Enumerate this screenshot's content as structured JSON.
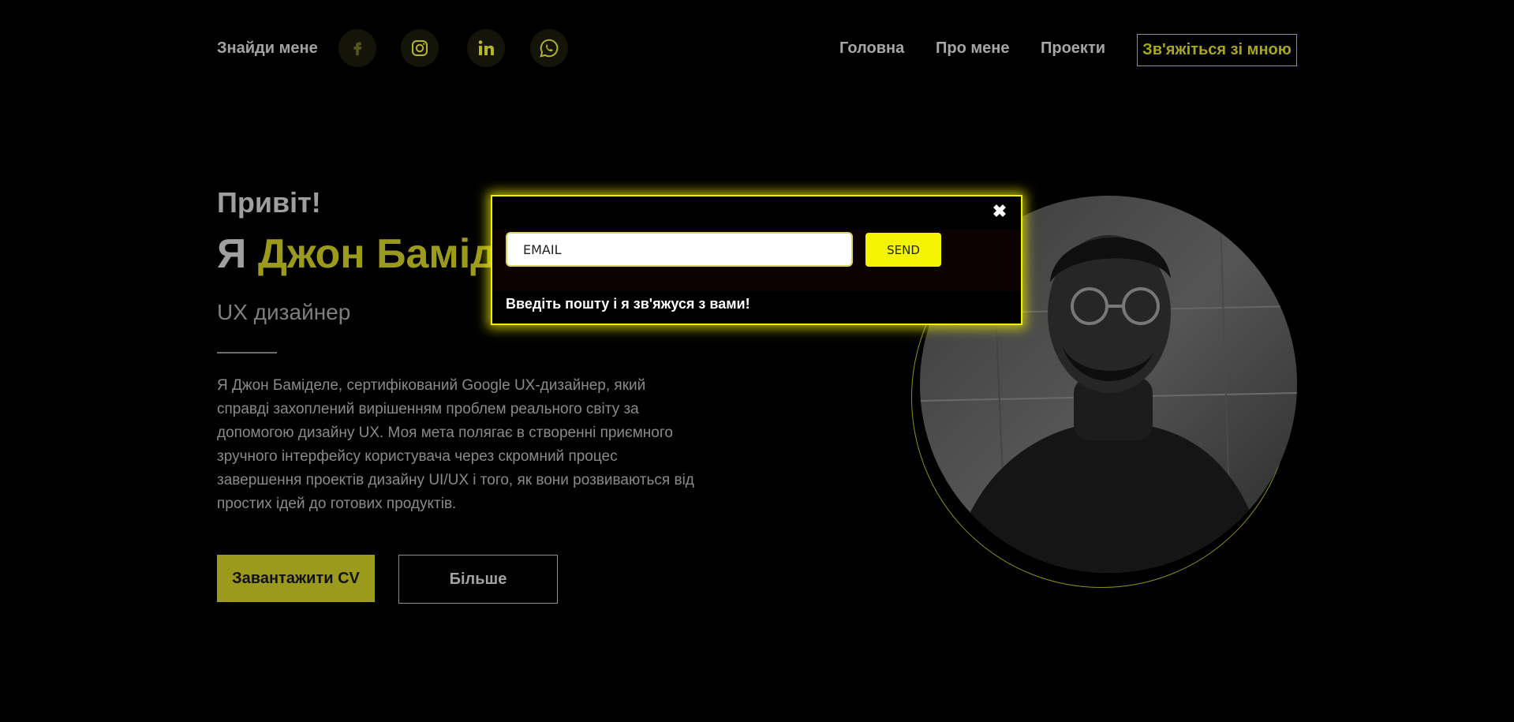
{
  "header": {
    "find_me": "Знайди мене",
    "socials": [
      {
        "icon": "facebook-icon"
      },
      {
        "icon": "instagram-icon"
      },
      {
        "icon": "linkedin-icon"
      },
      {
        "icon": "whatsapp-icon"
      }
    ],
    "nav": {
      "home": "Головна",
      "about": "Про мене",
      "projects": "Проекти",
      "contact": "Зв'яжіться зі мною"
    }
  },
  "hero": {
    "greeting": "Привіт!",
    "name_prefix": "Я",
    "name": "Джон Баміделе",
    "role": "UX дизайнер",
    "bio": "Я Джон Баміделе, сертифікований Google UX-дизайнер, який справді захоплений вирішенням проблем реального світу за допомогою дизайну UX. Моя мета полягає в створенні приємного зручного інтерфейсу користувача через скромний процес завершення проектів дизайну UI/UX і того, як вони розвиваються від простих ідей до готових продуктів.",
    "download_cv": "Завантажити CV",
    "more": "Більше"
  },
  "modal": {
    "email_value": "EMAIL",
    "send": "SEND",
    "close_glyph": "✖",
    "message": "Введіть пошту і я зв'яжуся з вами!"
  },
  "colors": {
    "accent": "#9b9a1c",
    "modal_border": "#f0f000",
    "send_button": "#f4f400",
    "background": "#000000"
  }
}
